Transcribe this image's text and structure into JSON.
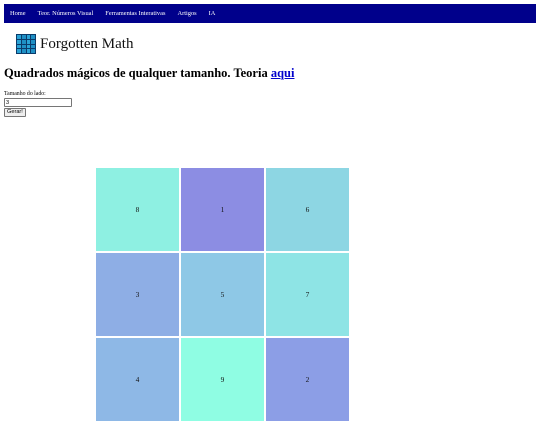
{
  "nav": {
    "items": [
      {
        "label": "Home"
      },
      {
        "label": "Teor. Números Visual"
      },
      {
        "label": "Ferramentas Interativas"
      },
      {
        "label": "Artigos"
      },
      {
        "label": "IA"
      }
    ],
    "background": "#00008b"
  },
  "brand": {
    "name": "Forgotten Math",
    "logo_icon": "grid-logo-icon"
  },
  "page": {
    "title": "Quadrados mágicos de qualquer tamanho. Teoria",
    "theory_link": "aqui"
  },
  "form": {
    "side_label": "Tamanho do lado:",
    "side_value": "3",
    "generate_button": "Gerar!"
  },
  "magic_square": {
    "size": 3,
    "cells": [
      {
        "value": "8",
        "color": "#8ef0e2"
      },
      {
        "value": "1",
        "color": "#8c8de3"
      },
      {
        "value": "6",
        "color": "#8dd6e3"
      },
      {
        "value": "3",
        "color": "#8eaee5"
      },
      {
        "value": "5",
        "color": "#8ec8e6"
      },
      {
        "value": "7",
        "color": "#8ee4e5"
      },
      {
        "value": "4",
        "color": "#8eb8e6"
      },
      {
        "value": "9",
        "color": "#8ffde3"
      },
      {
        "value": "2",
        "color": "#8c9ee6"
      }
    ]
  }
}
